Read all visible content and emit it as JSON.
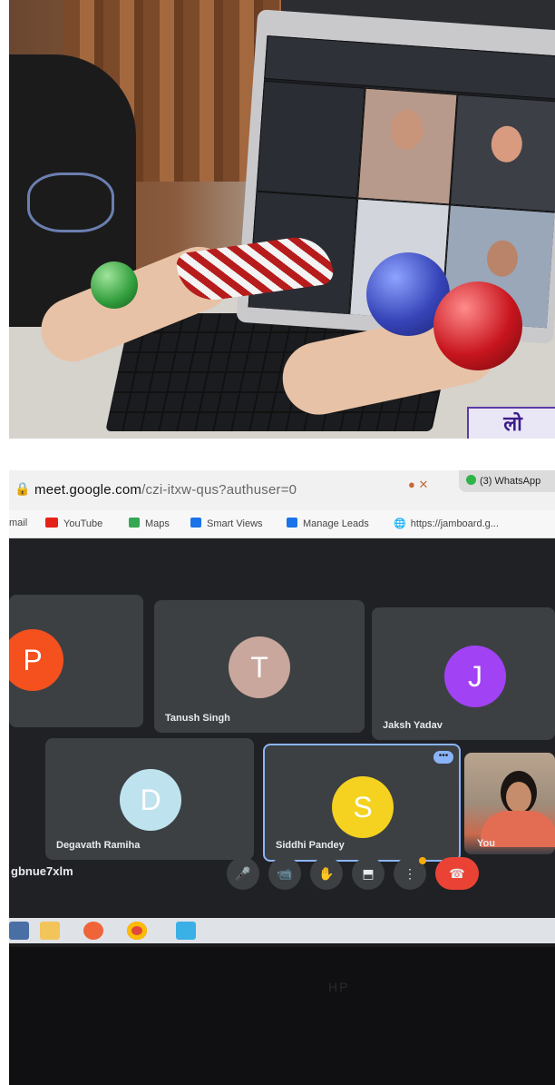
{
  "photo": {
    "sign_text": "लो"
  },
  "browser": {
    "url_host": "meet.google.com",
    "url_path": "/czi-itxw-qus?authuser=0",
    "ext_icons": "● ✕",
    "tab_title": "(3) WhatsApp",
    "bookmarks": [
      {
        "label": "mail",
        "icon": "gmail-icon",
        "color": "#ffffff"
      },
      {
        "label": "YouTube",
        "icon": "youtube-icon",
        "color": "#e62117"
      },
      {
        "label": "Maps",
        "icon": "maps-icon",
        "color": "#34a853"
      },
      {
        "label": "Smart Views",
        "icon": "smart-views-icon",
        "color": "#1a73e8"
      },
      {
        "label": "Manage Leads",
        "icon": "manage-leads-icon",
        "color": "#1a73e8"
      },
      {
        "label": "https://jamboard.g...",
        "icon": "globe-icon",
        "color": "#444444"
      }
    ]
  },
  "meet": {
    "participants": [
      {
        "initial": "P",
        "name": "",
        "color": "#f4511e"
      },
      {
        "initial": "T",
        "name": "Tanush Singh",
        "color": "#c9a79c"
      },
      {
        "initial": "J",
        "name": "Jaksh Yadav",
        "color": "#a142f4"
      },
      {
        "initial": "D",
        "name": "Degavath Ramiha",
        "color": "#bfe3ee"
      },
      {
        "initial": "S",
        "name": "Siddhi Pandey",
        "color": "#f4d21f"
      },
      {
        "initial": "",
        "name": "You",
        "color": ""
      }
    ],
    "more_badge": "•••",
    "meeting_code": "gbnue7xlm",
    "controls": {
      "mic": "🎤",
      "camera": "📹",
      "hand": "✋",
      "present": "⬒",
      "more": "⋮",
      "end": "☎"
    }
  },
  "laptop_brand": "HP"
}
